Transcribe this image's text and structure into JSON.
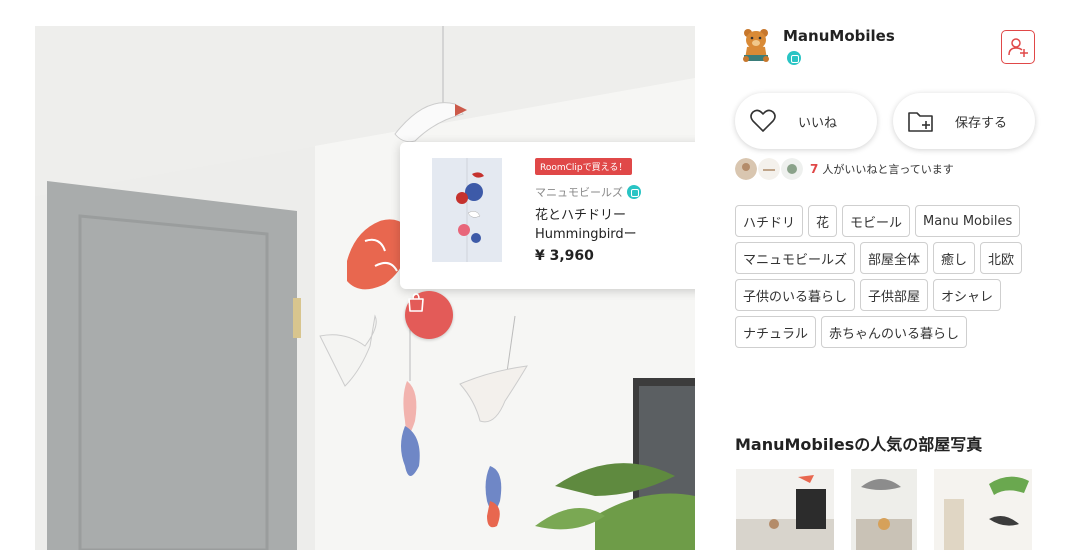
{
  "product": {
    "badge": "RoomClipで買える！",
    "shop": "マニュモビールズ",
    "name": "花とハチドリー Hummingbirdー",
    "price": "¥ 3,960"
  },
  "user": {
    "name": "ManuMobiles"
  },
  "actions": {
    "like_label": "いいね",
    "save_label": "保存する"
  },
  "likes": {
    "count": "7",
    "text": "人がいいねと言っています"
  },
  "tags": [
    "ハチドリ",
    "花",
    "モビール",
    "Manu Mobiles",
    "マニュモビールズ",
    "部屋全体",
    "癒し",
    "北欧",
    "子供のいる暮らし",
    "子供部屋",
    "オシャレ",
    "ナチュラル",
    "赤ちゃんのいる暮らし"
  ],
  "popular": {
    "title": "ManuMobilesの人気の部屋写真"
  },
  "colors": {
    "accent": "#e04848",
    "verified": "#29c4c4",
    "shop_button": "#e35b58"
  }
}
